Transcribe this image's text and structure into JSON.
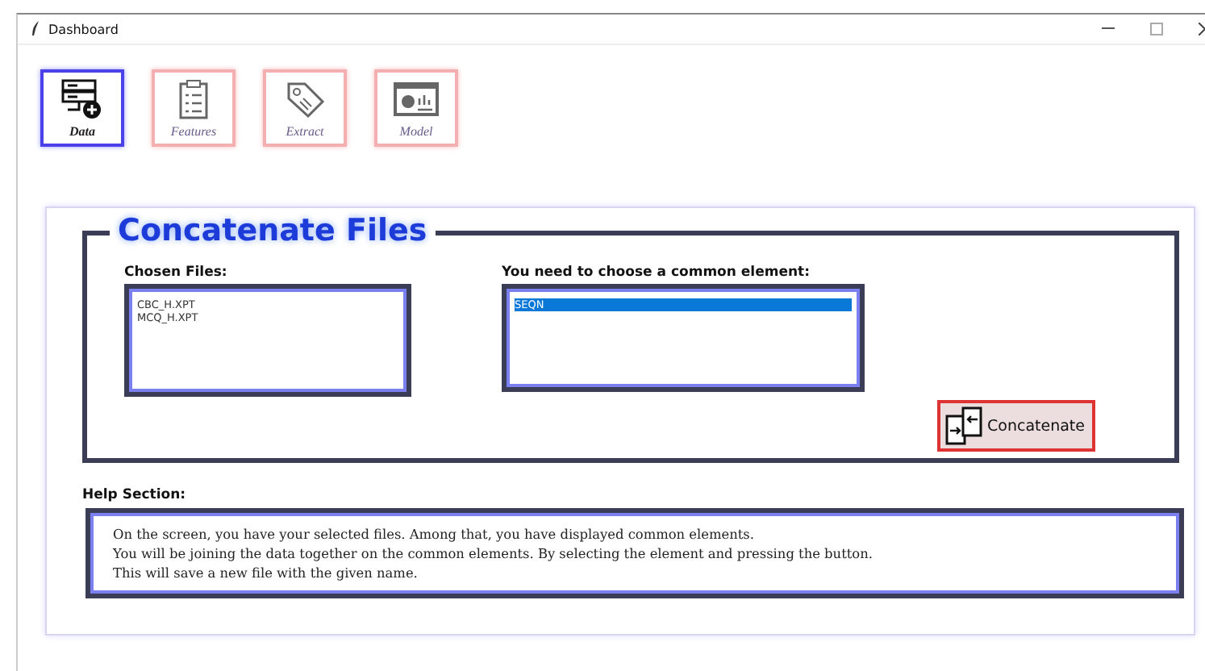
{
  "window": {
    "title": "Dashboard"
  },
  "tabs": [
    {
      "label": "Data",
      "selected": true
    },
    {
      "label": "Features",
      "selected": false
    },
    {
      "label": "Extract",
      "selected": false
    },
    {
      "label": "Model",
      "selected": false
    }
  ],
  "group": {
    "title": "Concatenate Files"
  },
  "chosen_files": {
    "label": "Chosen Files:",
    "items": [
      "CBC_H.XPT",
      "MCQ_H.XPT"
    ]
  },
  "common_element": {
    "label": "You need to choose a common element:",
    "items": [
      {
        "text": "SEQN",
        "selected": true
      }
    ]
  },
  "concatenate_button": {
    "label": "Concatenate"
  },
  "help": {
    "label": "Help Section:",
    "lines": [
      "On the screen, you have your selected files. Among that, you have displayed common elements.",
      "You will be joining the data together on the common elements. By selecting the element and pressing the button.",
      "This will save a new file with the given name."
    ]
  }
}
